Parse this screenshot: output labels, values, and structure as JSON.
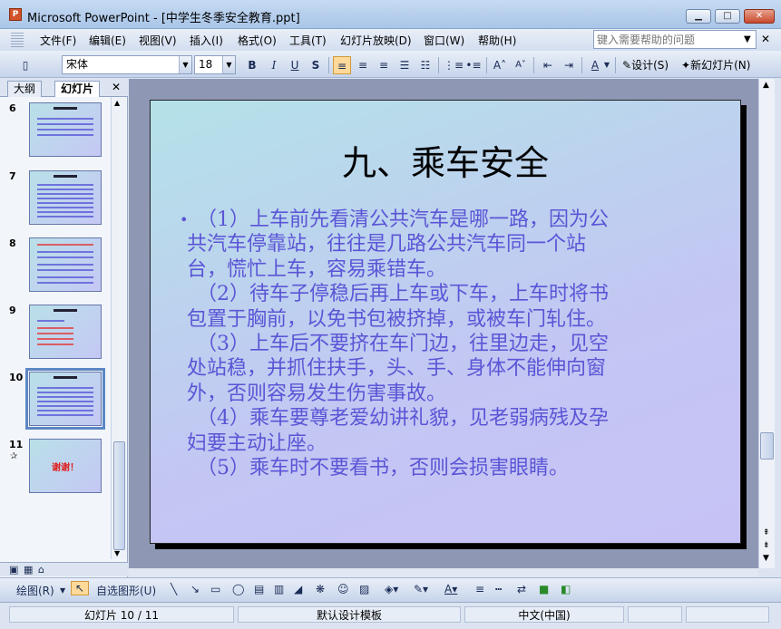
{
  "window": {
    "title": "Microsoft PowerPoint - [中学生冬季安全教育.ppt]",
    "app_icon": "P",
    "minimize": "▁",
    "maximize": "□",
    "close": "✕"
  },
  "menu": {
    "items": [
      "文件(F)",
      "编辑(E)",
      "视图(V)",
      "插入(I)",
      "格式(O)",
      "工具(T)",
      "幻灯片放映(D)",
      "窗口(W)",
      "帮助(H)"
    ],
    "help_placeholder": "键入需要帮助的问题"
  },
  "toolbar": {
    "font_name": "宋体",
    "font_size": "18",
    "bold": "B",
    "italic": "I",
    "underline": "U",
    "shadow": "S",
    "design_label": "设计(S)",
    "new_slide_label": "新幻灯片(N)"
  },
  "left_pane": {
    "tab_outline": "大纲",
    "tab_slides": "幻灯片",
    "close": "✕",
    "thumbnails": [
      {
        "num": "6"
      },
      {
        "num": "7"
      },
      {
        "num": "8"
      },
      {
        "num": "9"
      },
      {
        "num": "10"
      },
      {
        "num": "11",
        "text": "谢谢！"
      }
    ]
  },
  "slide": {
    "title": "九、乘车安全",
    "bullet": "•",
    "lines": [
      "　（1）上车前先看清公共汽车是哪一路，因为公",
      "共汽车停靠站，往往是几路公共汽车同一个站",
      "台，慌忙上车，容易乘错车。",
      "　（2）待车子停稳后再上车或下车，上车时将书",
      "包置于胸前，以免书包被挤掉，或被车门轧住。",
      "　（3）上车后不要挤在车门边，往里边走，见空",
      "处站稳，并抓住扶手，头、手、身体不能伸向窗",
      "外，否则容易发生伤害事故。",
      "　（4）乘车要尊老爱幼讲礼貌，见老弱病残及孕",
      "妇要主动让座。",
      "　（5）乘车时不要看书，否则会损害眼睛。"
    ]
  },
  "drawbar": {
    "draw_label": "绘图(R)",
    "autoshape_label": "自选图形(U)"
  },
  "status": {
    "slide_pos": "幻灯片 10 / 11",
    "design": "默认设计模板",
    "language": "中文(中国)"
  }
}
